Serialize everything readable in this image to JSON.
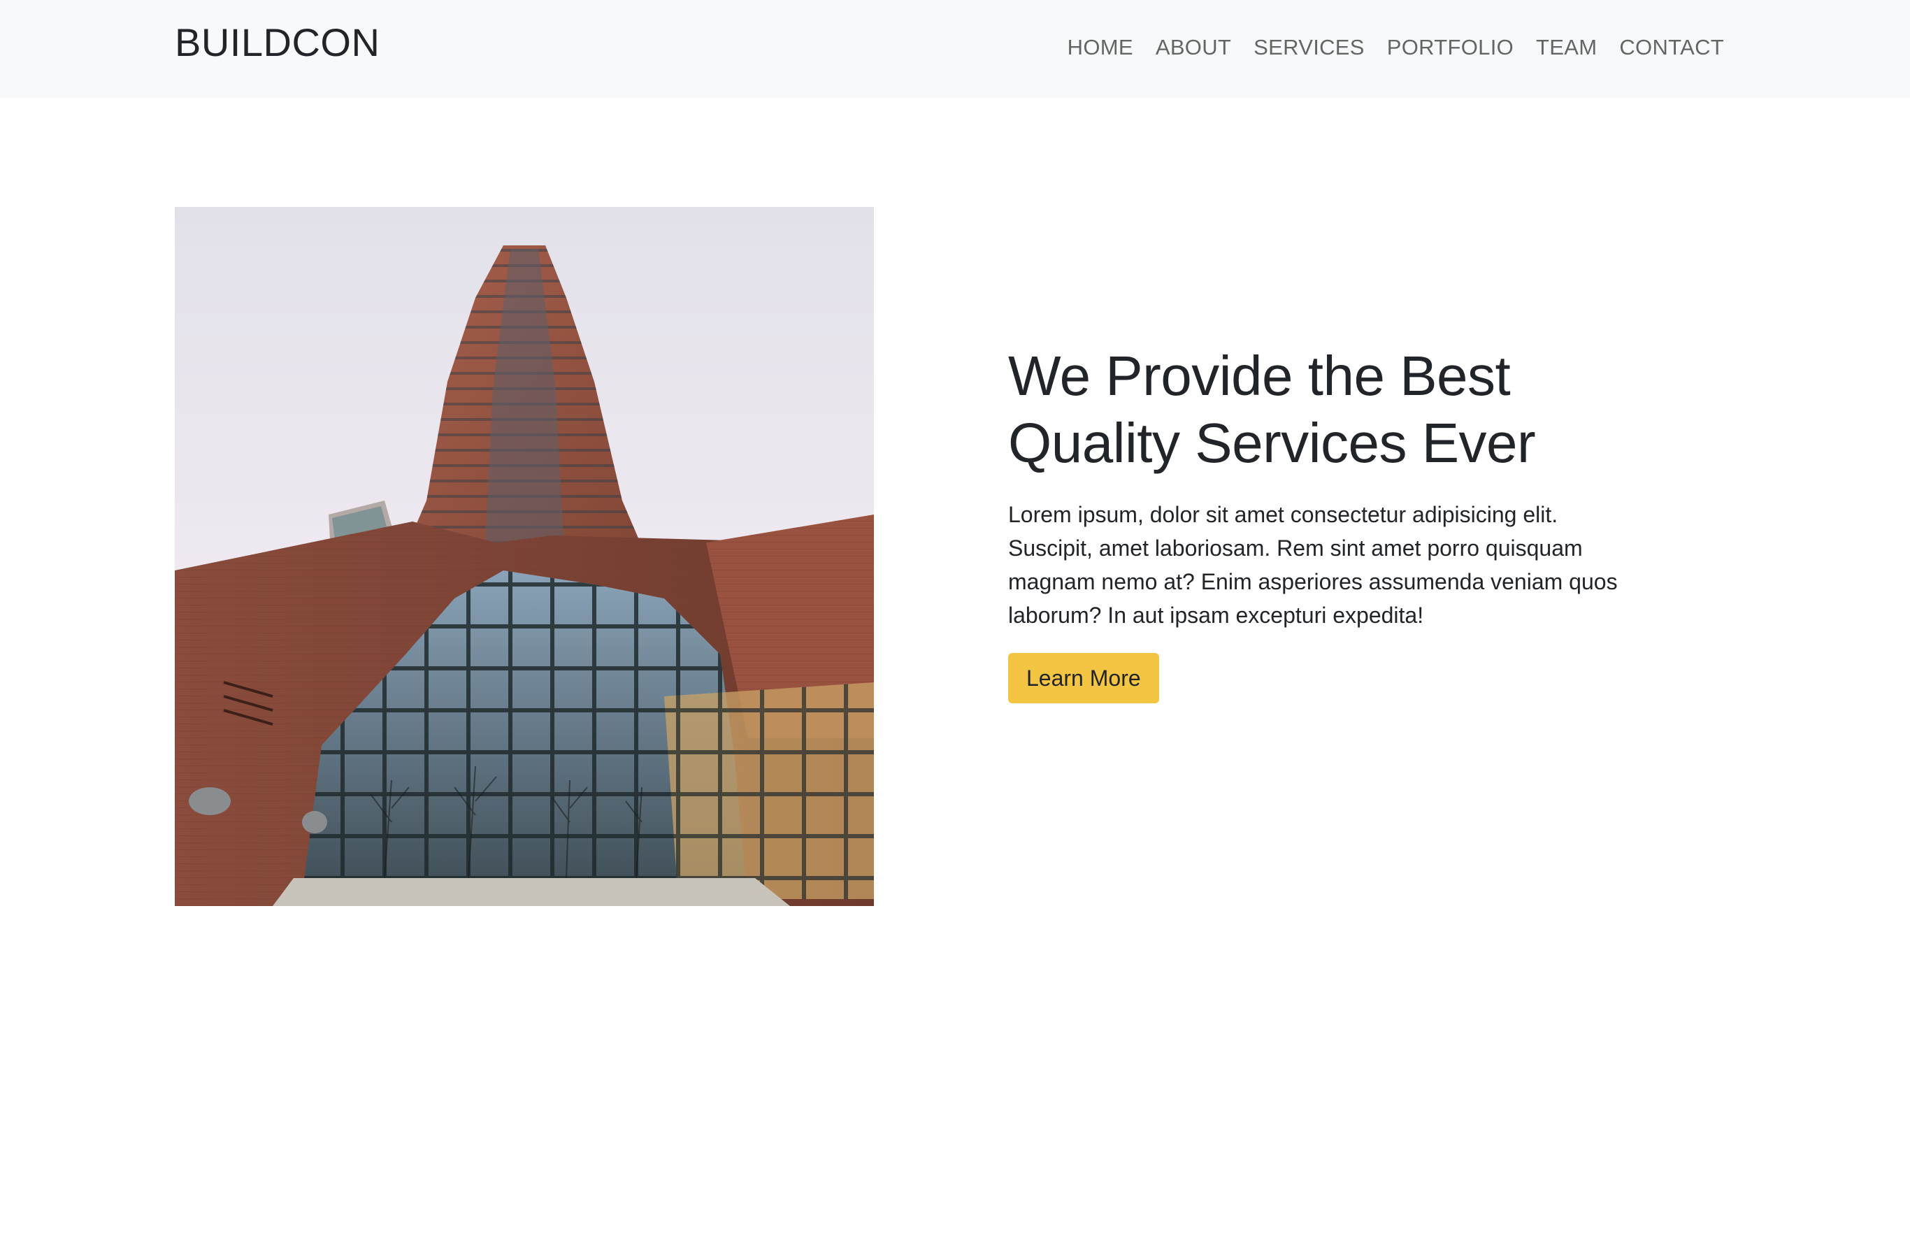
{
  "navbar": {
    "brand": "BUILDCON",
    "links": [
      "HOME",
      "ABOUT",
      "SERVICES",
      "PORTFOLIO",
      "TEAM",
      "CONTACT"
    ]
  },
  "hero": {
    "image": "skyscraper-photo",
    "headline": "We Provide the Best Quality Services Ever",
    "text": "Lorem ipsum, dolor sit amet consectetur adipisicing elit. Suscipit, amet laboriosam. Rem sint amet porro quisquam magnam nemo at? Enim asperiores assumenda veniam quos laborum? In aut ipsam excepturi expedita!",
    "button_label": "Learn More"
  },
  "colors": {
    "navbar_bg": "#f8f9fa",
    "accent": "#f4c542",
    "text": "#212529"
  }
}
